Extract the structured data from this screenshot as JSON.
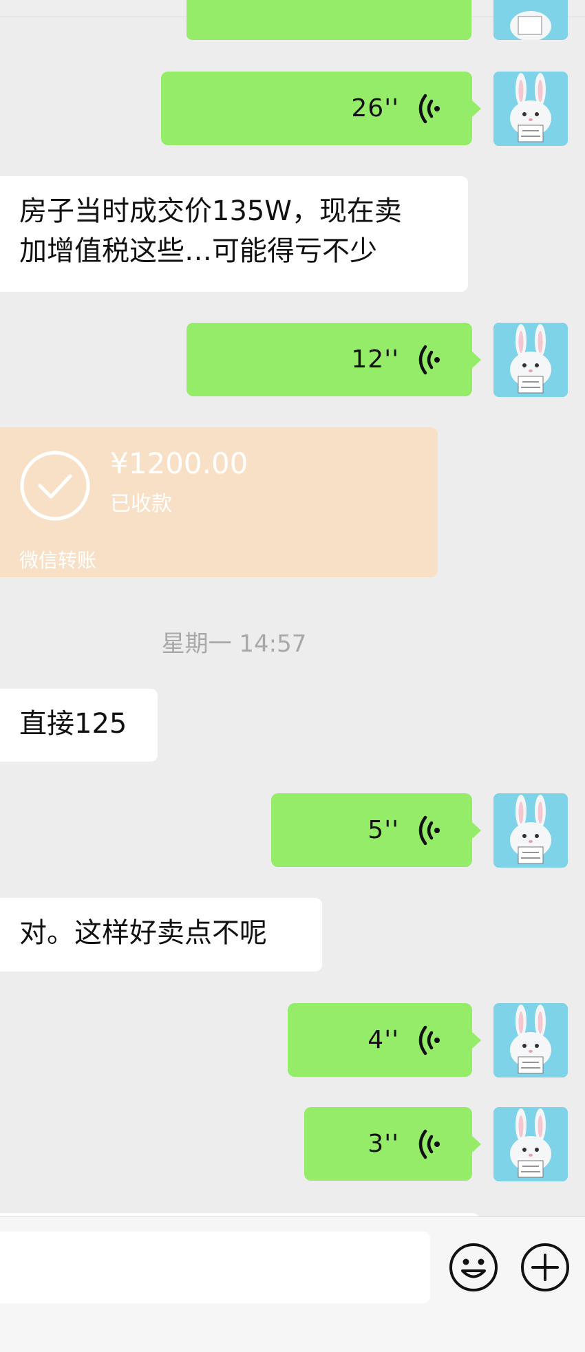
{
  "messages": {
    "voice_1": {
      "duration": "26''"
    },
    "text_1": {
      "line1": "房子当时成交价135W，现在卖",
      "line2": "加增值税这些…可能得亏不少"
    },
    "voice_2": {
      "duration": "12''"
    },
    "transfer": {
      "amount": "¥1200.00",
      "status": "已收款",
      "label": "微信转账"
    },
    "timestamp": "星期一 14:57",
    "text_2": "直接125",
    "voice_3": {
      "duration": "5''"
    },
    "text_3": "对。这样好卖点不呢",
    "voice_4": {
      "duration": "4''"
    },
    "voice_5": {
      "duration": "3''"
    }
  },
  "avatar": {
    "sign_text": "CUTE IS JUST MY COVER"
  },
  "input_bar": {
    "emoji_icon": "smiley-icon",
    "plus_icon": "plus-circle-icon"
  },
  "colors": {
    "sent_bubble": "#95ec69",
    "received_bubble": "#ffffff",
    "transfer_bubble": "#f8e0c6",
    "background": "#ededed"
  }
}
